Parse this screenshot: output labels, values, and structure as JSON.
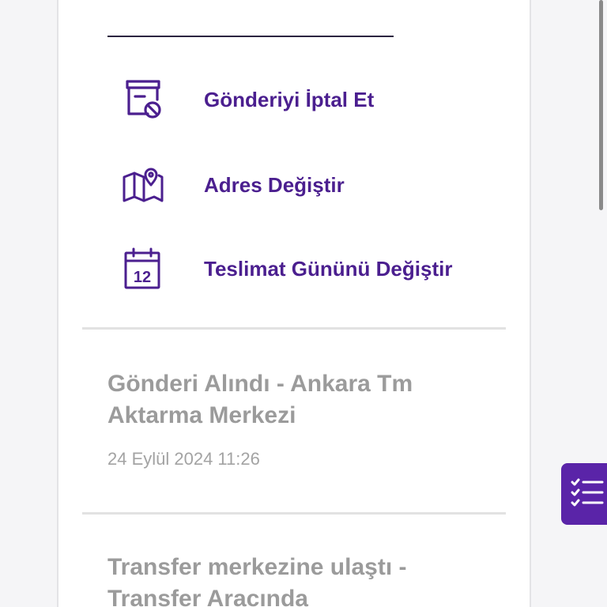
{
  "actions": [
    {
      "label": "Gönderiyi İptal Et",
      "icon": "cancel-shipment-icon"
    },
    {
      "label": "Adres Değiştir",
      "icon": "map-pin-icon"
    },
    {
      "label": "Teslimat Gününü Değiştir",
      "icon": "calendar-icon",
      "icon_text": "12"
    }
  ],
  "events": [
    {
      "title": "Gönderi Alındı - Ankara Tm Aktarma Merkezi",
      "time": "24 Eylül 2024 11:26"
    },
    {
      "title": "Transfer merkezine ulaştı - Transfer Aracında"
    }
  ],
  "fab": {
    "icon": "checklist-icon"
  },
  "colors": {
    "accent": "#4b1f8f",
    "fab": "#5a24a8",
    "muted_text": "#9b9b9b",
    "divider": "#e2e2e2"
  }
}
